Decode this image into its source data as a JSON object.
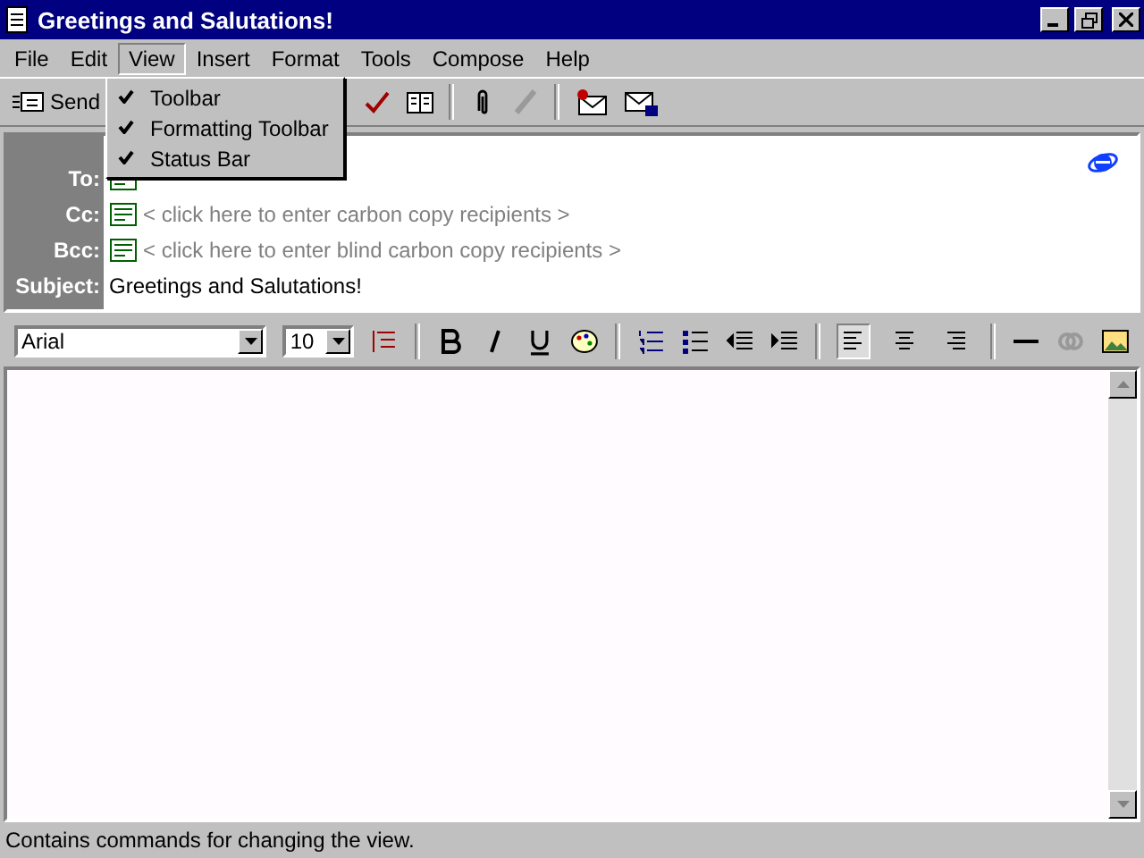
{
  "window": {
    "title": "Greetings and Salutations!"
  },
  "menu_bar": [
    {
      "label": "File",
      "selected": false
    },
    {
      "label": "Edit",
      "selected": false
    },
    {
      "label": "View",
      "selected": true
    },
    {
      "label": "Insert",
      "selected": false
    },
    {
      "label": "Format",
      "selected": false
    },
    {
      "label": "Tools",
      "selected": false
    },
    {
      "label": "Compose",
      "selected": false
    },
    {
      "label": "Help",
      "selected": false
    }
  ],
  "view_menu": [
    {
      "label": "Toolbar",
      "checked": true
    },
    {
      "label": "Formatting Toolbar",
      "checked": true
    },
    {
      "label": "Status Bar",
      "checked": true
    }
  ],
  "toolbar": {
    "send": "Send",
    "tools": [
      {
        "kind": "spell"
      },
      {
        "kind": "book"
      },
      {
        "kind": "sep"
      },
      {
        "kind": "clip"
      },
      {
        "kind": "signature",
        "disabled": true
      },
      {
        "kind": "sep"
      },
      {
        "kind": "sign"
      },
      {
        "kind": "encrypt"
      }
    ]
  },
  "header": [
    {
      "label": "To:",
      "kind": "blank"
    },
    {
      "label": "Cc:",
      "kind": "placeholder",
      "placeholder": "< click here to enter carbon copy recipients >"
    },
    {
      "label": "Bcc:",
      "kind": "placeholder",
      "placeholder": "< click here to enter blind carbon copy recipients >"
    },
    {
      "label": "Subject:",
      "kind": "value",
      "value": "Greetings and Salutations!"
    }
  ],
  "format_bar": {
    "font": "Arial",
    "size": "10",
    "align": [
      {
        "kind": "left",
        "selected": true
      },
      {
        "kind": "center",
        "selected": false
      },
      {
        "kind": "right",
        "selected": false
      }
    ]
  },
  "status_bar": "Contains commands for changing the view."
}
